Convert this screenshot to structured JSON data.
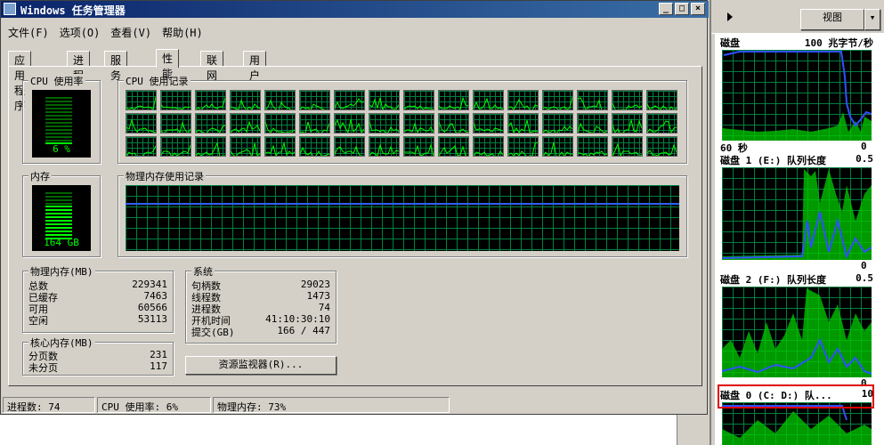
{
  "window": {
    "title": "Windows 任务管理器"
  },
  "menu": [
    "文件(F)",
    "选项(O)",
    "查看(V)",
    "帮助(H)"
  ],
  "tabs": [
    "应用程序",
    "进程",
    "服务",
    "性能",
    "联网",
    "用户"
  ],
  "active_tab": "性能",
  "cpu": {
    "label": "CPU 使用率",
    "value": "6 %",
    "level": 0.06,
    "history_label": "CPU 使用记录"
  },
  "memory": {
    "label": "内存",
    "value": "164 GB",
    "level": 0.73,
    "history_label": "物理内存使用记录"
  },
  "physical_memory": {
    "label": "物理内存(MB)",
    "rows": [
      {
        "k": "总数",
        "v": "229341"
      },
      {
        "k": "已缓存",
        "v": "7463"
      },
      {
        "k": "可用",
        "v": "60566"
      },
      {
        "k": "空闲",
        "v": "53113"
      }
    ]
  },
  "kernel_memory": {
    "label": "核心内存(MB)",
    "rows": [
      {
        "k": "分页数",
        "v": "231"
      },
      {
        "k": "未分页",
        "v": "117"
      }
    ]
  },
  "system": {
    "label": "系统",
    "rows": [
      {
        "k": "句柄数",
        "v": "29023"
      },
      {
        "k": "线程数",
        "v": "1473"
      },
      {
        "k": "进程数",
        "v": "74"
      },
      {
        "k": "开机时间",
        "v": "41:10:30:10"
      },
      {
        "k": "提交(GB)",
        "v": "166 / 447"
      }
    ]
  },
  "resource_monitor_button": "资源监视器(R)...",
  "statusbar": {
    "processes": "进程数: 74",
    "cpu": "CPU 使用率: 6%",
    "memory": "物理内存: 73%"
  },
  "right_pane": {
    "view_button": "视图",
    "graphs": [
      {
        "title": "磁盘",
        "max": "100 兆字节/秒",
        "min": "0",
        "time": "60 秒"
      },
      {
        "title": "磁盘 1 (E:) 队列长度",
        "max": "0.5",
        "min": "0"
      },
      {
        "title": "磁盘 2 (F:) 队列长度",
        "max": "0.5",
        "min": "0"
      },
      {
        "title": "磁盘 0 (C: D:) 队...",
        "max": "10"
      }
    ]
  },
  "colors": {
    "graph_green": "#00ff00",
    "graph_blue": "#3050ff",
    "highlight": "#e00000",
    "titlebar": "#0a246a"
  }
}
